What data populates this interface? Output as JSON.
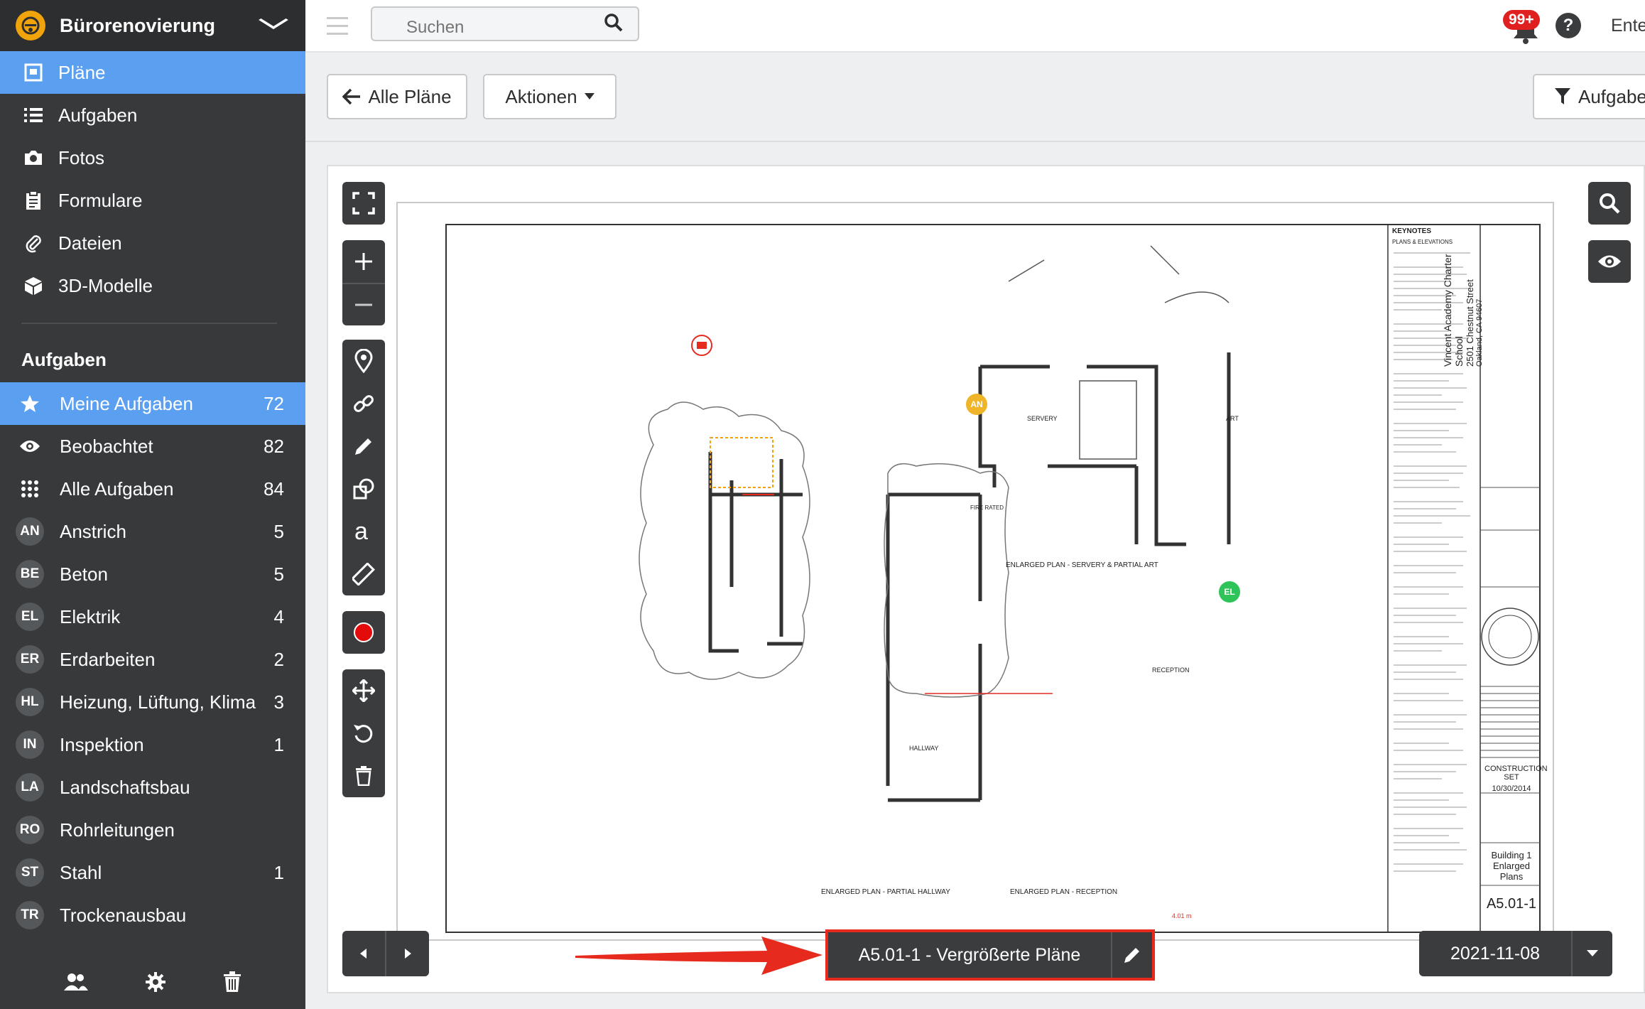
{
  "project": {
    "name": "Bürorenovierung"
  },
  "nav": [
    {
      "label": "Pläne",
      "icon": "plans-icon"
    },
    {
      "label": "Aufgaben",
      "icon": "list-icon"
    },
    {
      "label": "Fotos",
      "icon": "camera-icon"
    },
    {
      "label": "Formulare",
      "icon": "clipboard-icon"
    },
    {
      "label": "Dateien",
      "icon": "paperclip-icon"
    },
    {
      "label": "3D-Modelle",
      "icon": "cube-icon"
    }
  ],
  "tasks_section": "Aufgaben",
  "tasks": [
    {
      "label": "Meine Aufgaben",
      "count": "72",
      "icon": "star-icon"
    },
    {
      "label": "Beobachtet",
      "count": "82",
      "icon": "eye-icon"
    },
    {
      "label": "Alle Aufgaben",
      "count": "84",
      "icon": "grid-icon"
    },
    {
      "badge": "AN",
      "label": "Anstrich",
      "count": "5"
    },
    {
      "badge": "BE",
      "label": "Beton",
      "count": "5"
    },
    {
      "badge": "EL",
      "label": "Elektrik",
      "count": "4"
    },
    {
      "badge": "ER",
      "label": "Erdarbeiten",
      "count": "2"
    },
    {
      "badge": "HL",
      "label": "Heizung, Lüftung, Klima",
      "count": "3"
    },
    {
      "badge": "IN",
      "label": "Inspektion",
      "count": "1"
    },
    {
      "badge": "LA",
      "label": "Landschaftsbau",
      "count": ""
    },
    {
      "badge": "RO",
      "label": "Rohrleitungen",
      "count": ""
    },
    {
      "badge": "ST",
      "label": "Stahl",
      "count": "1"
    },
    {
      "badge": "TR",
      "label": "Trockenausbau",
      "count": ""
    }
  ],
  "search": {
    "placeholder": "Suchen"
  },
  "notifications": {
    "count": "99+"
  },
  "help": "?",
  "user_menu": "Ente",
  "toolbar": {
    "back_label": "Alle Pläne",
    "actions_label": "Aktionen",
    "filter_label": "Aufgabe"
  },
  "sheet": {
    "label": "A5.01-1 - Vergrößerte Pläne"
  },
  "date": {
    "label": "2021-11-08"
  },
  "drawing": {
    "keynotes_title": "KEYNOTES",
    "plans_elevations": "PLANS & ELEVATIONS",
    "project_title": "Vincent Academy Charter School",
    "project_address": "2501 Chestnut Street",
    "project_city": "Oakland, CA 94607",
    "issue": "CONSTRUCTION SET",
    "issue_date": "10/30/2014",
    "sheet_title": "Building 1 Enlarged Plans",
    "sheet_no": "A5.01-1",
    "plan1": "ENLARGED PLAN - SERVERY & PARTIAL ART",
    "plan2": "ENLARGED PLAN - PARTIAL HALLWAY",
    "plan3": "ENLARGED PLAN - RECEPTION",
    "room_servery": "SERVERY",
    "room_art": "ART",
    "room_reception": "RECEPTION",
    "room_hallway": "HALLWAY",
    "fire_rated": "FIRE RATED",
    "pin_an": "AN",
    "pin_el": "EL",
    "dim_label": "4.01 m"
  }
}
